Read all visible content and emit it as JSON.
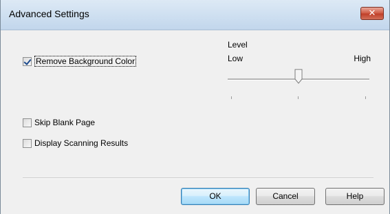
{
  "window": {
    "title": "Advanced Settings",
    "close_glyph": "✕"
  },
  "options": {
    "remove_background": {
      "label": "Remove Background Color",
      "checked": true
    },
    "skip_blank": {
      "label": "Skip Blank Page",
      "checked": false
    },
    "display_results": {
      "label": "Display Scanning Results",
      "checked": false
    }
  },
  "level_slider": {
    "label": "Level",
    "min_label": "Low",
    "max_label": "High",
    "value_fraction": 0.5
  },
  "buttons": {
    "ok": "OK",
    "cancel": "Cancel",
    "help": "Help"
  },
  "colors": {
    "titlebar": "#cfe0f1",
    "close": "#c0402a",
    "default_button": "#bee6fd",
    "check": "#1c4a8c"
  }
}
